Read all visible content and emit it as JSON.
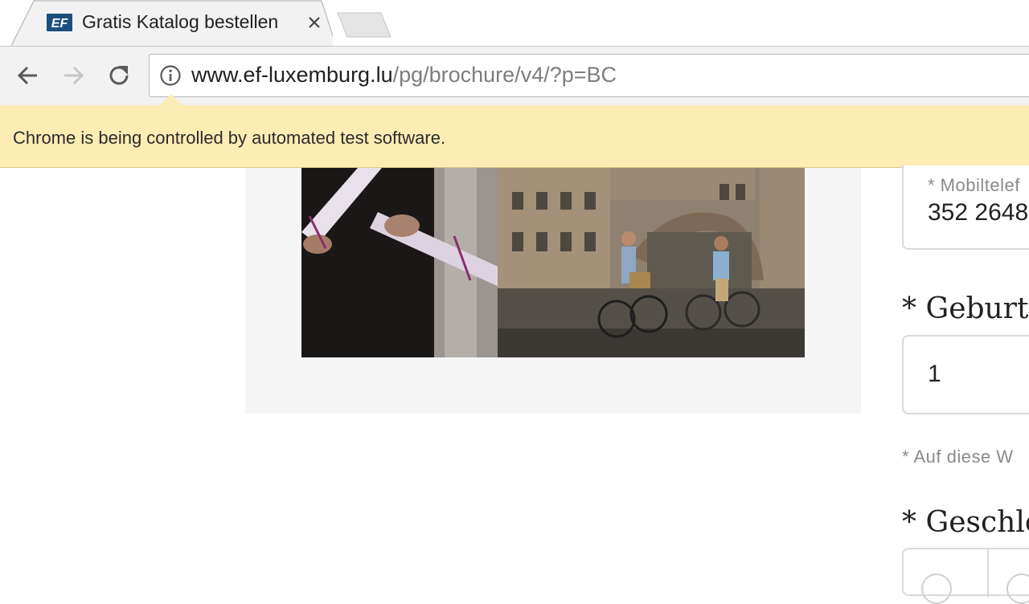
{
  "browser": {
    "tab": {
      "title": "Gratis Katalog bestellen",
      "favicon": "EF"
    },
    "url": {
      "host": "www.ef-luxemburg.lu",
      "path": "/pg/brochure/v4/?p=BC"
    },
    "infobar": {
      "message": "Chrome is being controlled by automated test software."
    }
  },
  "form": {
    "mobile": {
      "label": "* Mobiltelef",
      "value": "352 2648"
    },
    "birthdate": {
      "heading": "* Geburtsd",
      "day_value": "1"
    },
    "required_hint": "* Auf diese W",
    "gender": {
      "heading": "* Geschlec"
    }
  },
  "colors": {
    "infobar_bg": "#feecb5",
    "toolbar_bg": "#f2f2f2",
    "panel_bg": "#f5f5f5",
    "favicon_blue": "#1c4f7d"
  }
}
